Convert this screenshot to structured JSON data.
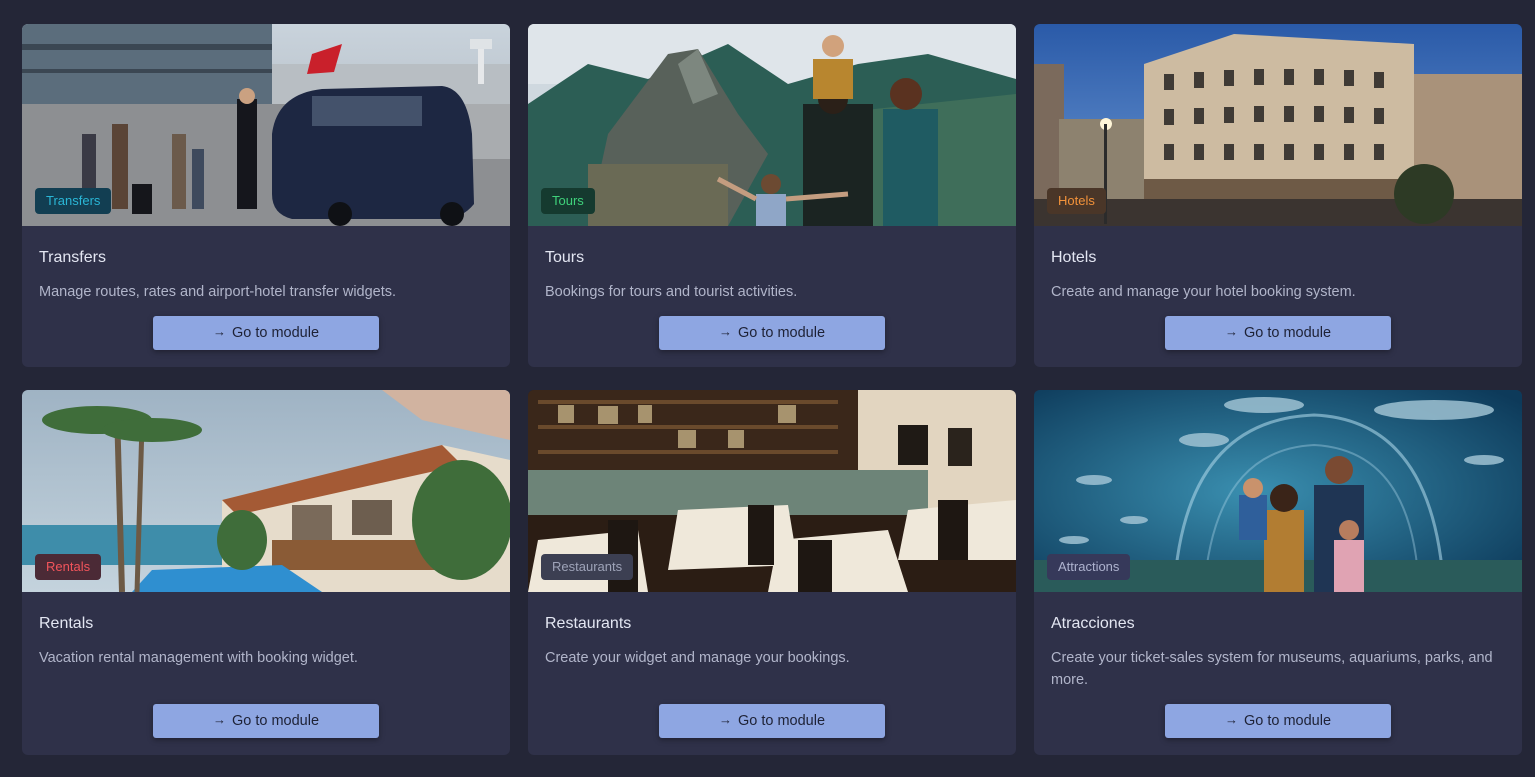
{
  "modules": [
    {
      "id": "transfers",
      "badge": "Transfers",
      "badge_color": "#2ab6d6",
      "badge_bg": "#123e52",
      "title": "Transfers",
      "description": "Manage routes, rates and airport-hotel transfer widgets.",
      "button": "Go to module",
      "image": "airport-van-photo"
    },
    {
      "id": "tours",
      "badge": "Tours",
      "badge_color": "#3fd27b",
      "badge_bg": "#153a2f",
      "title": "Tours",
      "description": "Bookings for tours and tourist activities.",
      "button": "Go to module",
      "image": "mountain-family-photo"
    },
    {
      "id": "hotels",
      "badge": "Hotels",
      "badge_color": "#f3923a",
      "badge_bg": "#4a3628",
      "title": "Hotels",
      "description": "Create and manage your hotel booking system.",
      "button": "Go to module",
      "image": "hotel-building-photo"
    },
    {
      "id": "rentals",
      "badge": "Rentals",
      "badge_color": "#f2545b",
      "badge_bg": "#4b2a36",
      "title": "Rentals",
      "description": "Vacation rental management with booking widget.",
      "button": "Go to module",
      "image": "beach-villa-photo"
    },
    {
      "id": "restaurants",
      "badge": "Restaurants",
      "badge_color": "#9ea3b8",
      "badge_bg": "#3c3f52",
      "title": "Restaurants",
      "description": "Create your widget and manage your bookings.",
      "button": "Go to module",
      "image": "restaurant-interior-photo"
    },
    {
      "id": "attractions",
      "badge": "Attractions",
      "badge_color": "#aeb3cf",
      "badge_bg": "#36395a",
      "title": "Atracciones",
      "description": "Create your ticket-sales system for museums, aquariums, parks, and more.",
      "button": "Go to module",
      "image": "aquarium-tunnel-photo"
    }
  ],
  "icons": {
    "button_icon": "arrow-right-icon",
    "arrow_glyph": "→"
  }
}
